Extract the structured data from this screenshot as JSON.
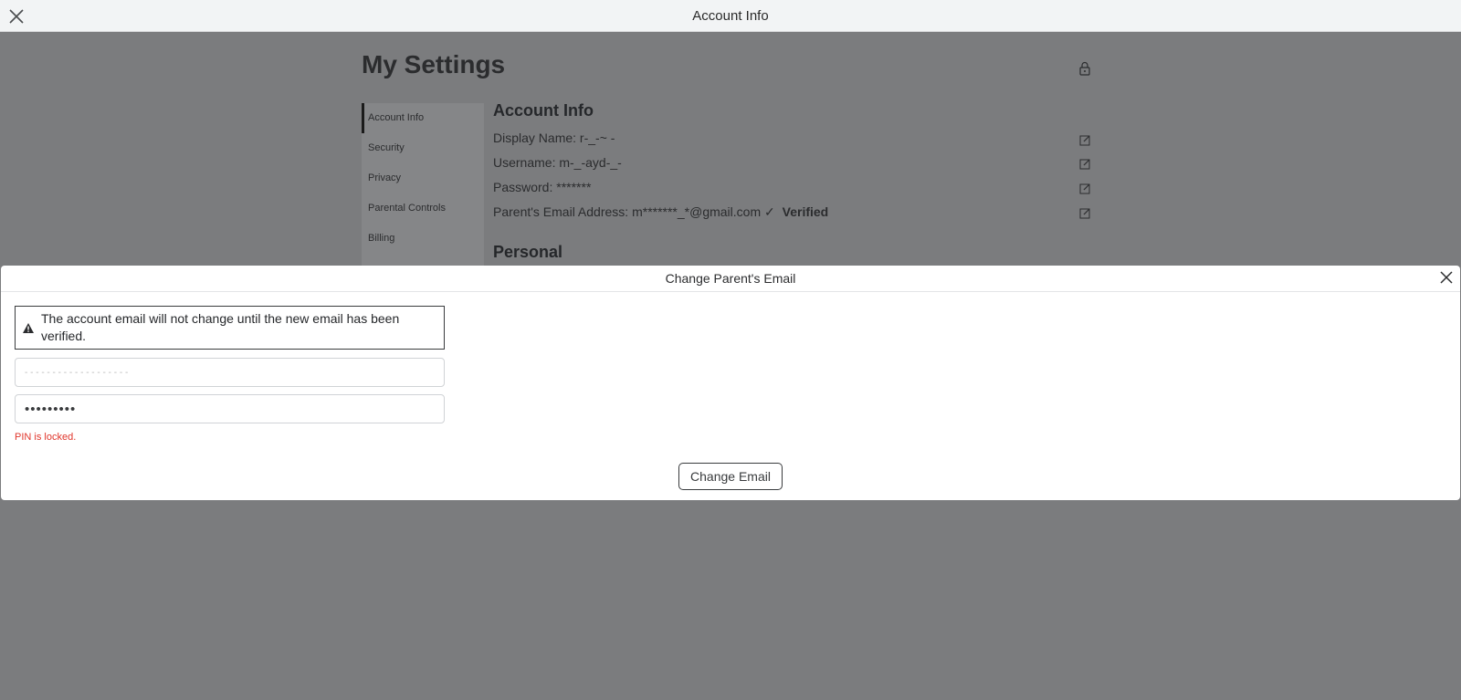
{
  "window": {
    "title": "Account Info"
  },
  "settings": {
    "heading": "My Settings",
    "nav": [
      "Account Info",
      "Security",
      "Privacy",
      "Parental Controls",
      "Billing"
    ],
    "section_title": "Account Info",
    "rows": [
      {
        "label": "Display Name:",
        "value": "r-_-~ -"
      },
      {
        "label": "Username:",
        "value": "m-_-ayd-_-"
      },
      {
        "label": "Password:",
        "value": "*******"
      },
      {
        "label": "Parent's Email Address:",
        "value": "m*******_*@gmail.com",
        "status": "Verified"
      }
    ],
    "personal_title": "Personal"
  },
  "modal": {
    "title": "Change Parent's Email",
    "warning": "The account email will not change until the new email has been verified.",
    "email_value": "- - - - - - - - - - - - - - - - - - -",
    "password_value": "•••••••••",
    "error": "PIN is locked.",
    "button": "Change Email"
  }
}
